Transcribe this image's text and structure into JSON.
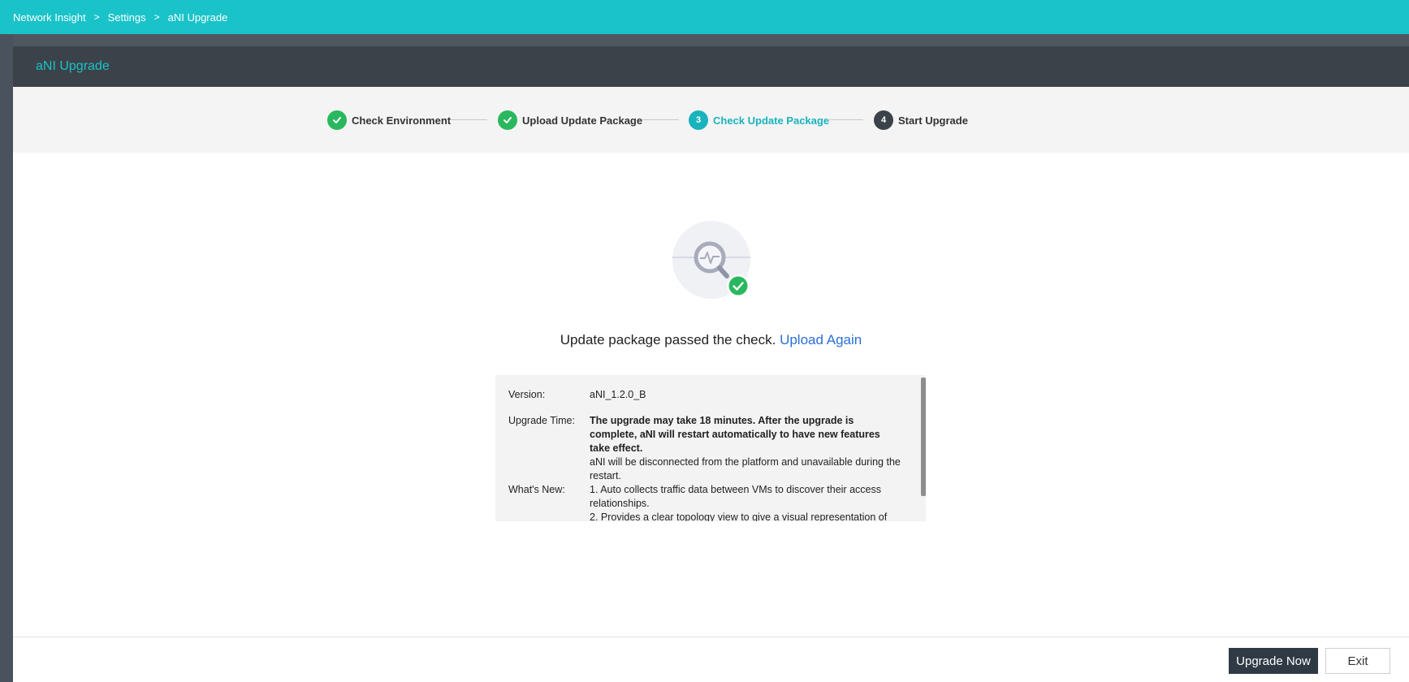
{
  "breadcrumb": {
    "items": [
      "Network Insight",
      "Settings",
      "aNI Upgrade"
    ],
    "separator": ">"
  },
  "header": {
    "title": "aNI Upgrade"
  },
  "steps": [
    {
      "label": "Check Environment",
      "state": "done",
      "number": "1"
    },
    {
      "label": "Upload Update Package",
      "state": "done",
      "number": "2"
    },
    {
      "label": "Check Update Package",
      "state": "current",
      "number": "3"
    },
    {
      "label": "Start Upgrade",
      "state": "pending",
      "number": "4"
    }
  ],
  "status": {
    "message": "Update package passed the check.",
    "link": "Upload Again"
  },
  "details": {
    "version_label": "Version:",
    "version_value": "aNI_1.2.0_B",
    "upgrade_time_label": "Upgrade Time:",
    "upgrade_time_bold": "The upgrade may take 18 minutes. After the upgrade is complete, aNI will restart automatically to have new features take effect.",
    "upgrade_time_note": "aNI will be disconnected from the platform and unavailable during the restart.",
    "whats_new_label": "What's New:",
    "whats_new_items": [
      "1. Auto collects traffic data between VMs to discover their access relationships.",
      "2. Provides a clear topology view to give a visual representation of"
    ]
  },
  "footer": {
    "upgrade_now": "Upgrade Now",
    "exit": "Exit"
  },
  "colors": {
    "brand": "#19c3c9",
    "success": "#2ab85f",
    "link": "#2a6fd6",
    "primary_button": "#2f3a45"
  }
}
